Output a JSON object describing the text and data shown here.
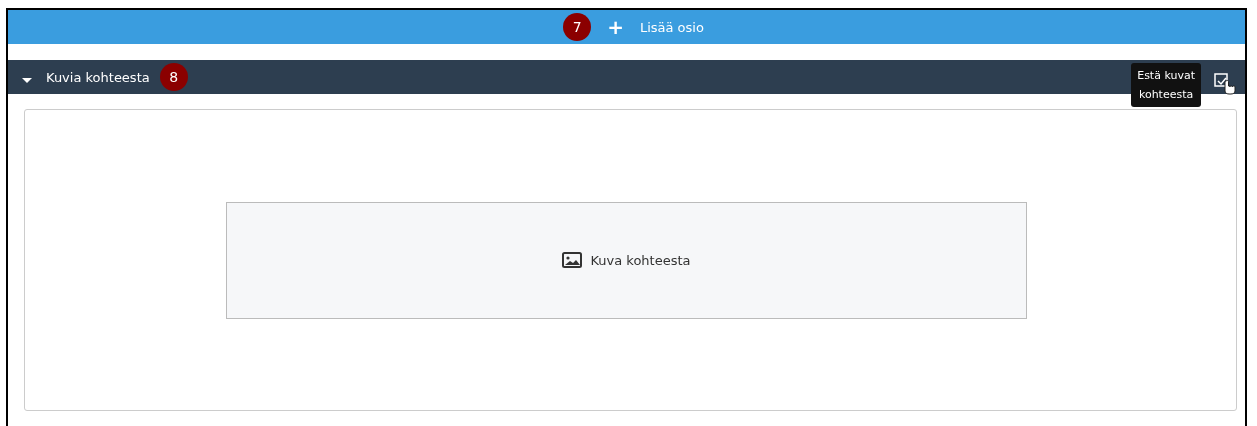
{
  "add_section_bar": {
    "step_badge": "7",
    "icon": "+",
    "label": "Lisää osio"
  },
  "section": {
    "expanded": true,
    "title": "Kuvia kohteesta",
    "step_badge": "8",
    "tooltip": "Estä kuvat\nkohteesta",
    "image_placeholder": {
      "label": "Kuva kohteesta"
    }
  }
}
